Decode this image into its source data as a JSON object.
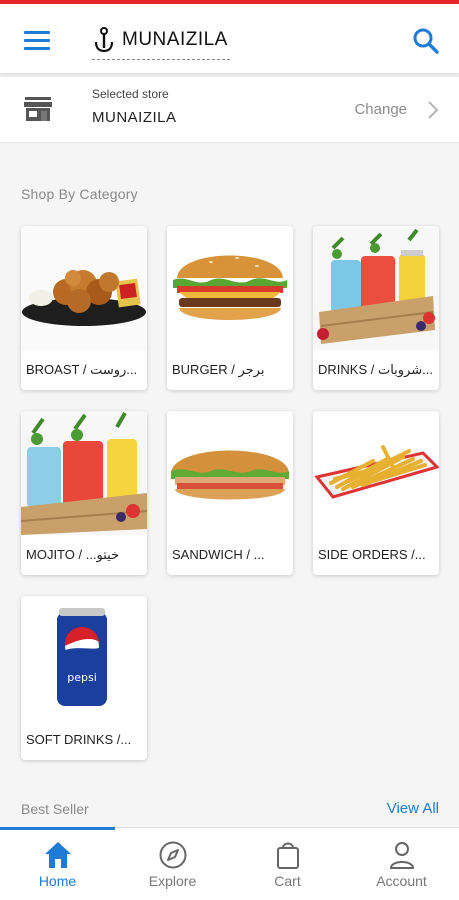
{
  "header": {
    "brand": "MUNAIZILA",
    "icons": {
      "menu": "hamburger-menu-icon",
      "search": "search-icon",
      "logo": "anchor-pin-icon"
    }
  },
  "store": {
    "caption": "Selected store",
    "name": "MUNAIZILA",
    "change_label": "Change",
    "icon": "store-icon"
  },
  "categories_section": {
    "title": "Shop By Category",
    "items": [
      {
        "label": "BROAST / روست...",
        "image": "fried-chicken"
      },
      {
        "label": "BURGER / برجر",
        "image": "burger"
      },
      {
        "label": "DRINKS / شروبات...",
        "image": "drinks-crate"
      },
      {
        "label": "MOJITO / ...خيتو",
        "image": "mojito-crate"
      },
      {
        "label": "SANDWICH / ...",
        "image": "sandwich"
      },
      {
        "label": "SIDE ORDERS /...",
        "image": "french-fries"
      },
      {
        "label": "SOFT DRINKS /...",
        "image": "pepsi-can"
      }
    ]
  },
  "best_seller": {
    "title": "Best Seller",
    "view_all_label": "View All"
  },
  "bottom_nav": {
    "items": [
      {
        "label": "Home",
        "icon": "home-icon",
        "active": true
      },
      {
        "label": "Explore",
        "icon": "compass-icon",
        "active": false
      },
      {
        "label": "Cart",
        "icon": "bag-icon",
        "active": false
      },
      {
        "label": "Account",
        "icon": "person-icon",
        "active": false
      }
    ]
  },
  "colors": {
    "accent": "#1e7bd6",
    "top_line": "#e8232a",
    "muted_text": "#8a8a8a"
  }
}
